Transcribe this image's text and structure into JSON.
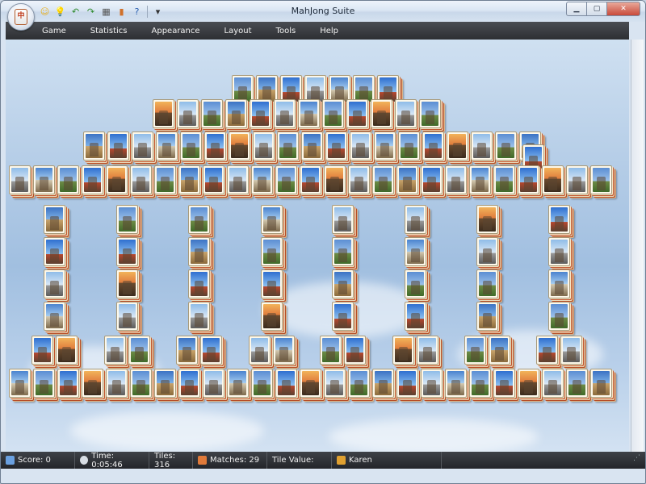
{
  "window": {
    "title": "MahJong Suite"
  },
  "quick_access": [
    {
      "icon": "smiley-icon",
      "glyph": "☺",
      "color": "#e8b020"
    },
    {
      "icon": "hint-bulb-icon",
      "glyph": "💡",
      "color": "#d8a800"
    },
    {
      "icon": "undo-icon",
      "glyph": "↶",
      "color": "#2f8a2f"
    },
    {
      "icon": "redo-icon",
      "glyph": "↷",
      "color": "#2f8a2f"
    },
    {
      "icon": "layout-icon",
      "glyph": "▦",
      "color": "#555"
    },
    {
      "icon": "statistics-icon",
      "glyph": "▮",
      "color": "#d0702a"
    },
    {
      "icon": "help-icon",
      "glyph": "?",
      "color": "#2a5fb0"
    },
    {
      "icon": "customize-dropdown-icon",
      "glyph": "▾",
      "color": "#333"
    }
  ],
  "menu": [
    "Game",
    "Statistics",
    "Appearance",
    "Layout",
    "Tools",
    "Help"
  ],
  "status": {
    "score": "Score: 0",
    "time": "Time: 0:05:46",
    "tiles": "Tiles: 316",
    "matches": "Matches: 29",
    "tile_value": "Tile Value:",
    "player": "Karen"
  }
}
